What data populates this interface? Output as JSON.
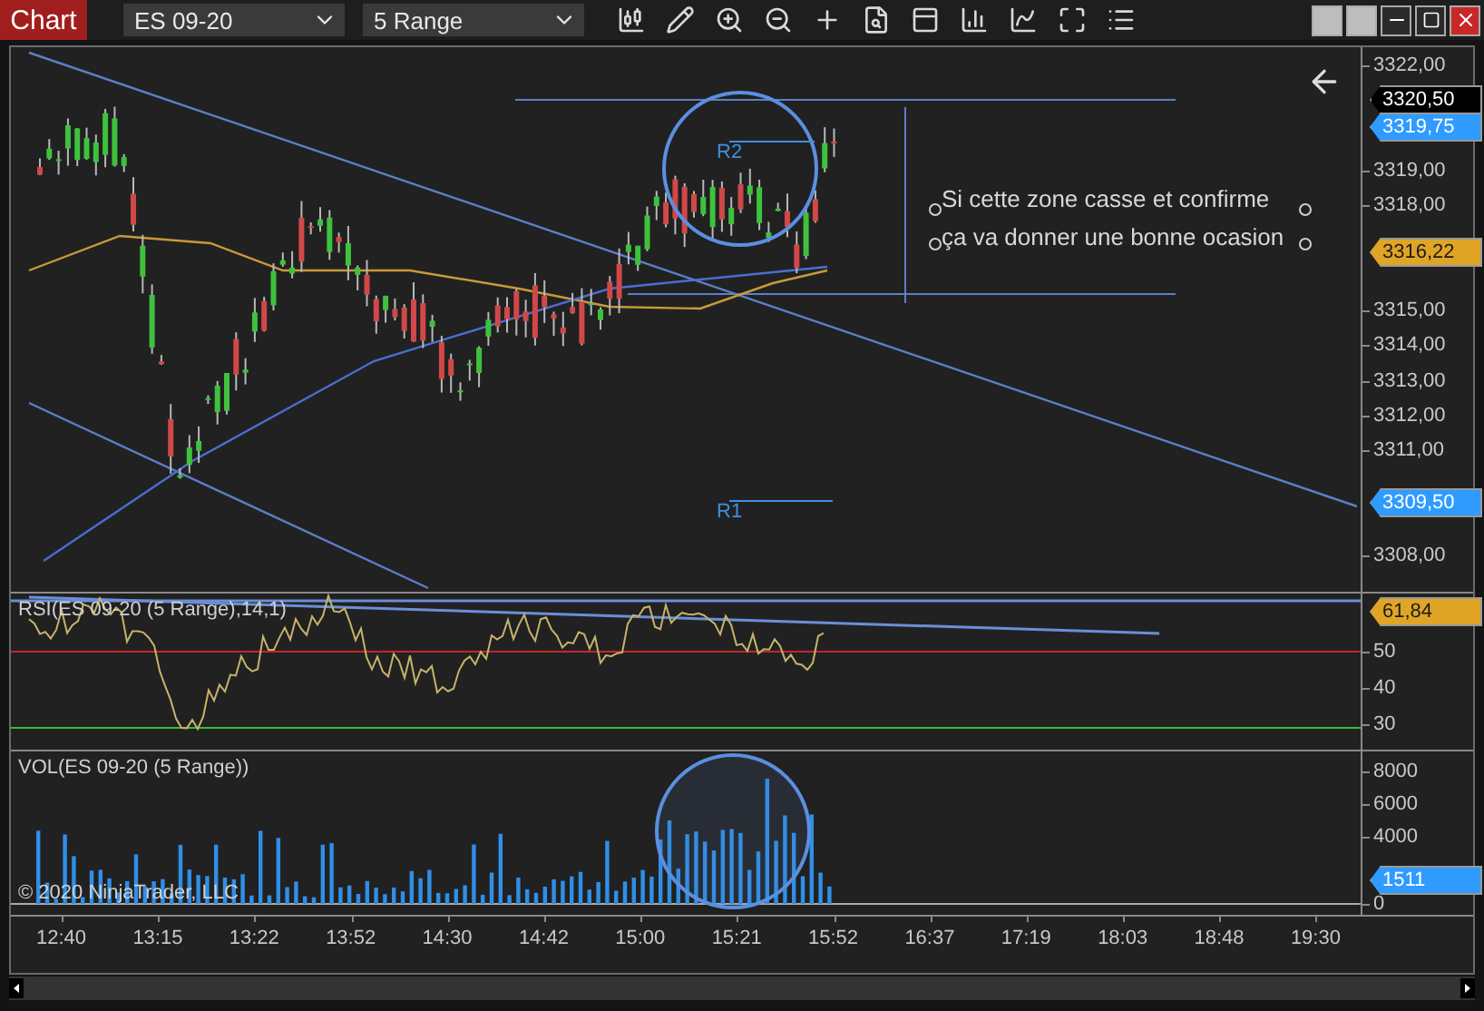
{
  "toolbar": {
    "title": "Chart",
    "instrument": "ES 09-20",
    "period": "5 Range"
  },
  "price_panel": {
    "axis_labels": [
      "3322,00",
      "3319,00",
      "3318,00",
      "3315,00",
      "3314,00",
      "3313,00",
      "3312,00",
      "3311,00",
      "3308,00"
    ],
    "price_badges": [
      {
        "value": "3320,50",
        "color": "#000000"
      },
      {
        "value": "3319,75",
        "color": "#2f9bff"
      },
      {
        "value": "3316,22",
        "color": "#e0a526"
      },
      {
        "value": "3309,50",
        "color": "#2f9bff"
      }
    ],
    "annotation": [
      "Si cette zone casse et confirme",
      "ça va donner une bonne ocasion"
    ],
    "levels": [
      "R2",
      "R1"
    ]
  },
  "rsi_panel": {
    "title": "RSI(ES 09-20 (5 Range),14,1)",
    "axis_labels": [
      "50",
      "40",
      "30"
    ],
    "badge": "61,84"
  },
  "volume_panel": {
    "title": "VOL(ES 09-20 (5 Range))",
    "axis_labels": [
      "8000",
      "6000",
      "4000",
      "0"
    ],
    "badge": "1511",
    "copyright": "© 2020 NinjaTrader, LLC"
  },
  "time_axis": [
    "12:40",
    "13:15",
    "13:22",
    "13:52",
    "14:30",
    "14:42",
    "15:00",
    "15:21",
    "15:52",
    "16:37",
    "17:19",
    "18:03",
    "18:48",
    "19:30"
  ]
}
